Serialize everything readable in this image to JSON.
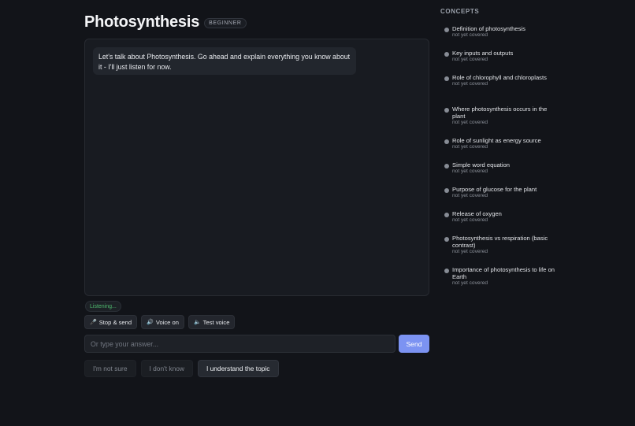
{
  "header": {
    "title": "Photosynthesis",
    "level": "BEGINNER"
  },
  "chat": {
    "messages": [
      {
        "role": "tutor",
        "text": "Let's talk about Photosynthesis. Go ahead and explain everything you know about it - I'll just listen for now."
      }
    ]
  },
  "voice": {
    "status": "Listening...",
    "status_color": "#4eb86e",
    "controls": [
      {
        "icon": "microphone-icon",
        "glyph": "🎤",
        "label": "Stop & send"
      },
      {
        "icon": "speaker-icon",
        "glyph": "🔊",
        "label": "Voice on"
      },
      {
        "icon": "speaker-test-icon",
        "glyph": "🔈",
        "label": "Test voice"
      }
    ]
  },
  "input": {
    "placeholder": "Or type your answer...",
    "value": "",
    "send_label": "Send",
    "send_color": "#7c93f2"
  },
  "quick_replies": [
    {
      "label": "I'm not sure",
      "primary": false
    },
    {
      "label": "I don't know",
      "primary": false
    },
    {
      "label": "I understand the topic",
      "primary": true
    }
  ],
  "sidebar": {
    "title": "CONCEPTS",
    "concepts": [
      {
        "name": "Definition of photosynthesis",
        "status": "not yet covered"
      },
      {
        "name": "Key inputs and outputs",
        "status": "not yet covered"
      },
      {
        "name": "Role of chlorophyll and chloroplasts",
        "status": "not yet covered"
      },
      {
        "name": "Where photosynthesis occurs in the plant",
        "status": "not yet covered"
      },
      {
        "name": "Role of sunlight as energy source",
        "status": "not yet covered"
      },
      {
        "name": "Simple word equation",
        "status": "not yet covered"
      },
      {
        "name": "Purpose of glucose for the plant",
        "status": "not yet covered"
      },
      {
        "name": "Release of oxygen",
        "status": "not yet covered"
      },
      {
        "name": "Photosynthesis vs respiration (basic contrast)",
        "status": "not yet covered"
      },
      {
        "name": "Importance of photosynthesis to life on Earth",
        "status": "not yet covered"
      }
    ]
  }
}
